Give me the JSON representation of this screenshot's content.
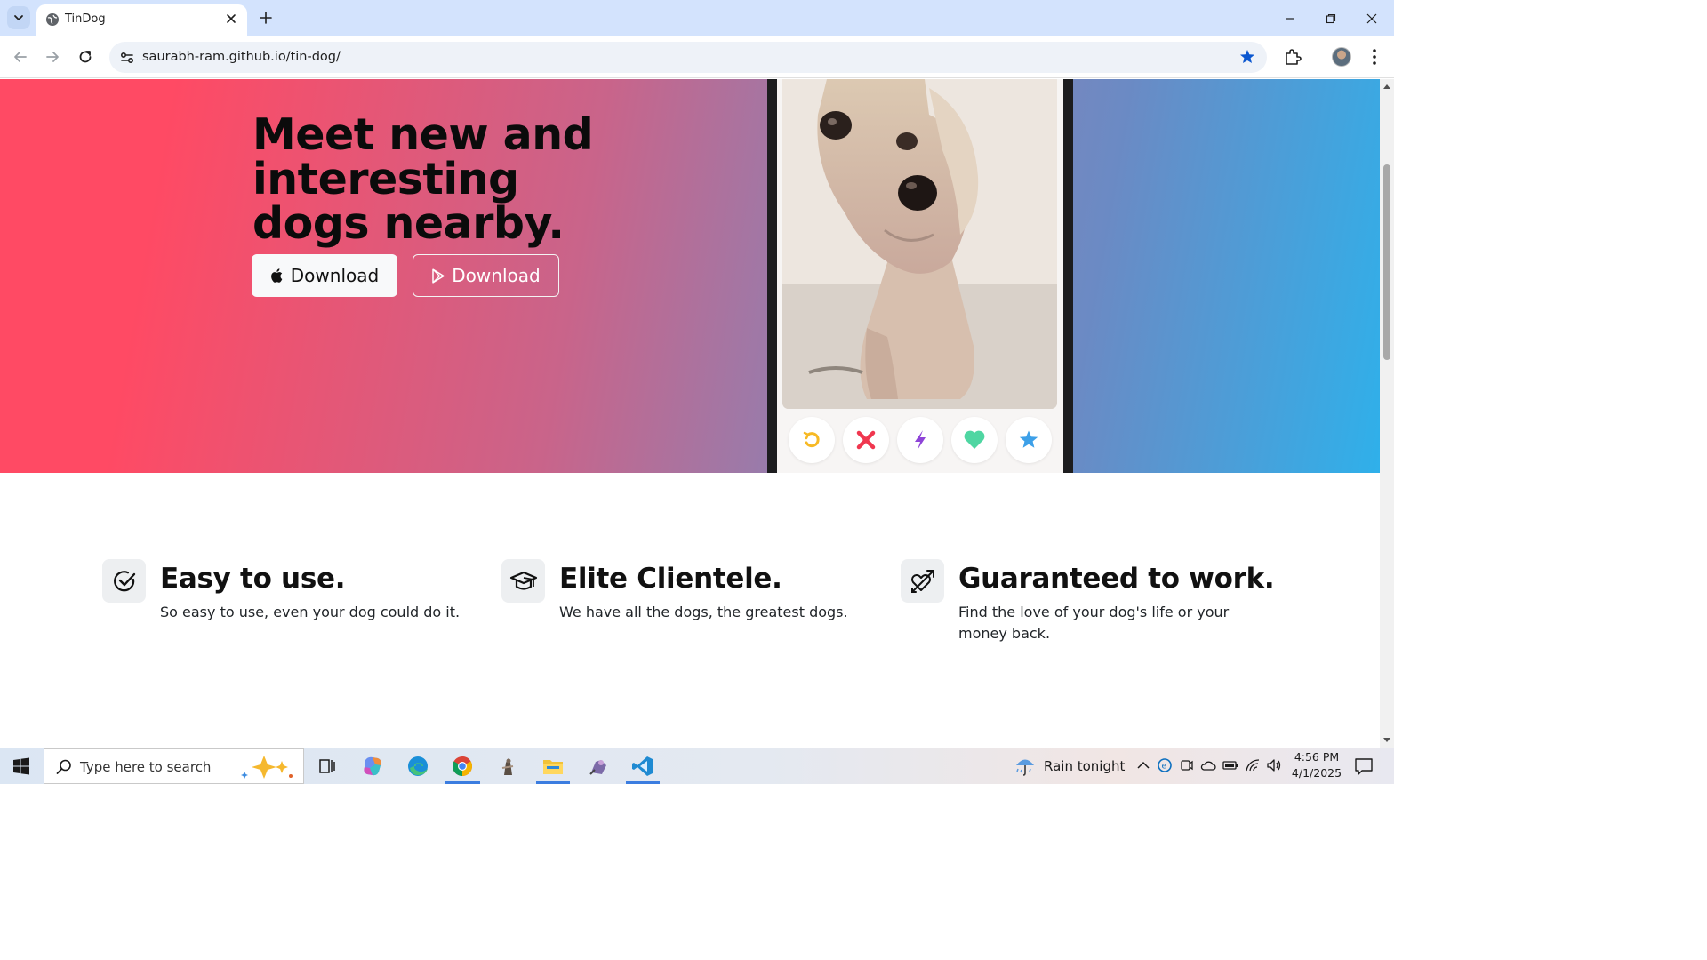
{
  "browser": {
    "tab_title": "TinDog",
    "url": "saurabh-ram.github.io/tin-dog/"
  },
  "hero": {
    "title": "Meet new and interesting dogs nearby.",
    "apple_button_label": "Download",
    "play_button_label": "Download",
    "gradient_colors": [
      "#ff4a64",
      "#c9648a",
      "#8b82b4",
      "#2fb0ea"
    ]
  },
  "phone": {
    "actions": [
      "undo-icon",
      "close-icon",
      "bolt-icon",
      "heart-icon",
      "star-icon"
    ]
  },
  "features": [
    {
      "icon": "check-circle-icon",
      "title": "Easy to use.",
      "description": "So easy to use, even your dog could do it."
    },
    {
      "icon": "graduation-cap-icon",
      "title": "Elite Clientele.",
      "description": "We have all the dogs, the greatest dogs."
    },
    {
      "icon": "heart-arrow-icon",
      "title": "Guaranteed to work.",
      "description": "Find the love of your dog's life or your money back."
    }
  ],
  "taskbar": {
    "search_placeholder": "Type here to search",
    "weather": "Rain tonight",
    "time": "4:56 PM",
    "date": "4/1/2025",
    "apps": [
      "task-view-icon",
      "copilot-icon",
      "edge-icon",
      "chrome-icon",
      "app-icon",
      "file-explorer-icon",
      "app-icon-2",
      "vscode-icon"
    ]
  }
}
